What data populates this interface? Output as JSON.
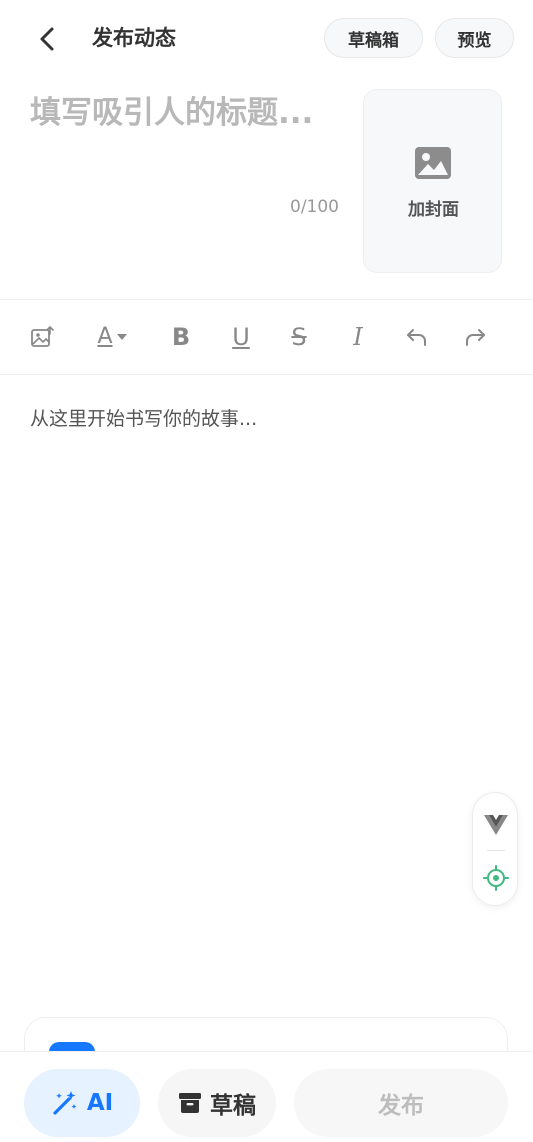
{
  "header": {
    "title": "发布动态",
    "drafts_box_label": "草稿箱",
    "preview_label": "预览"
  },
  "title_field": {
    "placeholder": "填写吸引人的标题...",
    "char_count": "0/100"
  },
  "cover": {
    "label": "加封面"
  },
  "toolbar": {
    "items": [
      "image-insert-icon",
      "font-color-icon",
      "bold-icon",
      "underline-icon",
      "strikethrough-icon",
      "italic-icon",
      "undo-icon",
      "redo-icon"
    ],
    "font_letter": "A",
    "bold_letter": "B",
    "underline_letter": "U",
    "strike_letter": "S",
    "italic_letter": "I"
  },
  "editor": {
    "placeholder": "从这里开始书写你的故事..."
  },
  "bottom_bar": {
    "ai_label": "AI",
    "draft_label": "草稿",
    "publish_label": "发布"
  },
  "colors": {
    "accent": "#1677ff",
    "accent_bg": "#e6f2ff",
    "float_green": "#42b983"
  }
}
